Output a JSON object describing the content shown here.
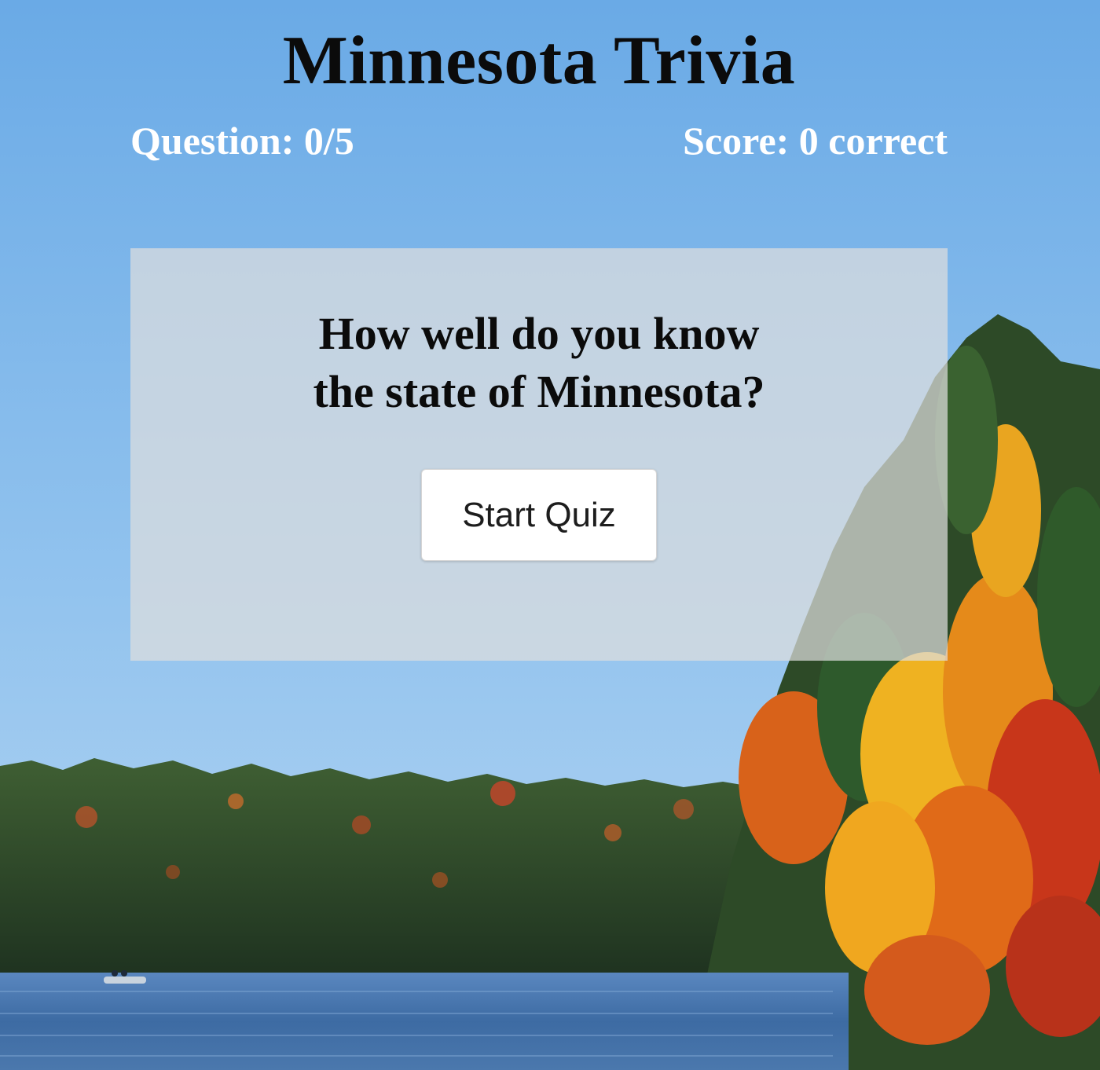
{
  "header": {
    "title": "Minnesota Trivia",
    "question_counter": "Question: 0/5",
    "score_counter": "Score: 0 correct"
  },
  "quiz_panel": {
    "intro_line_1": "How well do you know",
    "intro_line_2": "the state of Minnesota?",
    "start_button_label": "Start Quiz"
  },
  "background": {
    "description_icon": "autumn-lake-landscape",
    "sky_color": "#7db6e8",
    "water_color": "#3c6fa8",
    "foliage_colors": [
      "#2f4a2a",
      "#e0701a",
      "#f0b020",
      "#c83a1a"
    ]
  }
}
